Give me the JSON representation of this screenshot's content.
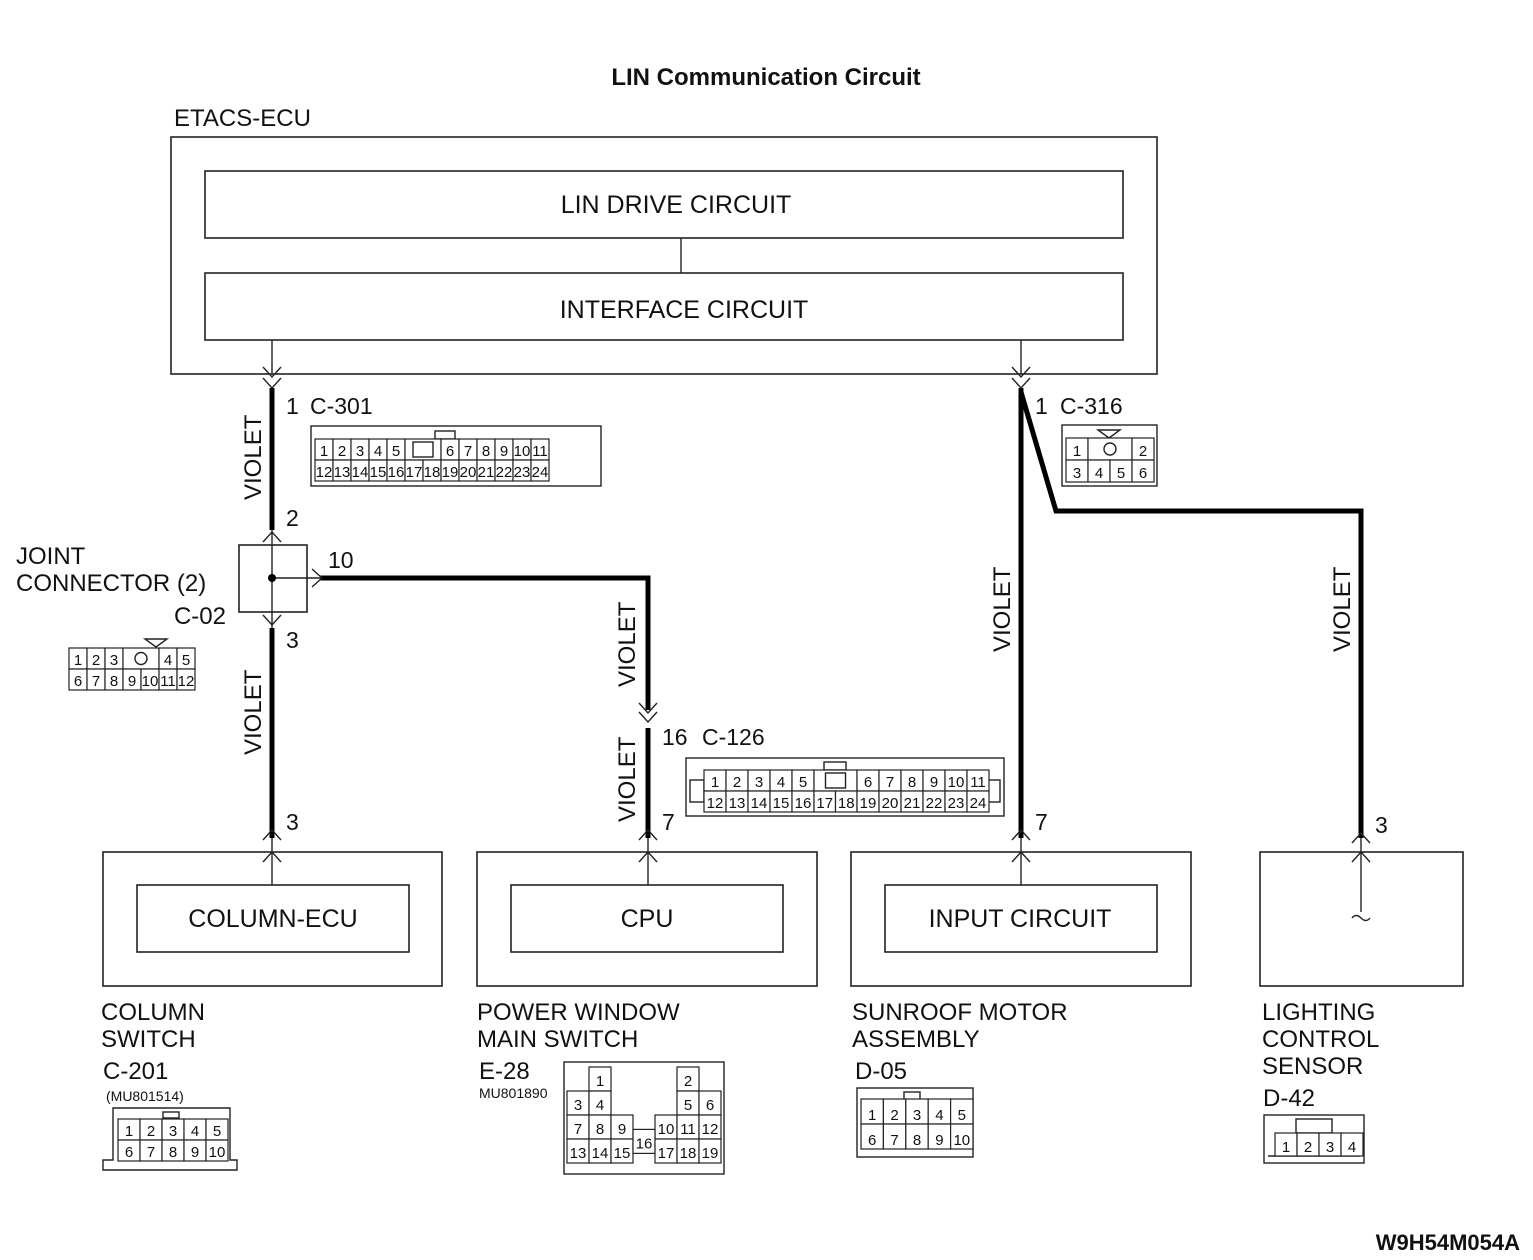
{
  "title": "LIN Communication Circuit",
  "footer_code": "W9H54M054A",
  "wire_color_label": "VIOLET",
  "etacs": {
    "name": "ETACS-ECU",
    "lin_drive": "LIN DRIVE CIRCUIT",
    "interface": "INTERFACE CIRCUIT"
  },
  "connectors": {
    "c301": {
      "pin": "1",
      "id": "C-301",
      "rows": [
        [
          "1",
          "2",
          "3",
          "4",
          "5",
          "",
          "6",
          "7",
          "8",
          "9",
          "10",
          "11"
        ],
        [
          "12",
          "13",
          "14",
          "15",
          "16",
          "17",
          "18",
          "19",
          "20",
          "21",
          "22",
          "23",
          "24"
        ]
      ]
    },
    "c316": {
      "pin": "1",
      "id": "C-316",
      "rows": [
        [
          "1",
          "O",
          "2"
        ],
        [
          "3",
          "4",
          "5",
          "6"
        ]
      ]
    },
    "joint": {
      "name_line1": "JOINT",
      "name_line2": "CONNECTOR (2)",
      "id": "C-02",
      "pin_in": "2",
      "pin_out_right": "10",
      "pin_out_down": "3",
      "rows": [
        [
          "1",
          "2",
          "3",
          "O",
          "4",
          "5"
        ],
        [
          "6",
          "7",
          "8",
          "9",
          "10",
          "11",
          "12"
        ]
      ]
    },
    "c126": {
      "pin": "16",
      "id": "C-126",
      "rows": [
        [
          "1",
          "2",
          "3",
          "4",
          "5",
          "",
          "6",
          "7",
          "8",
          "9",
          "10",
          "11"
        ],
        [
          "12",
          "13",
          "14",
          "15",
          "16",
          "17",
          "18",
          "19",
          "20",
          "21",
          "22",
          "23",
          "24"
        ]
      ]
    }
  },
  "devices": [
    {
      "key": "column",
      "pin": "3",
      "inner": "COLUMN-ECU",
      "name_lines": [
        "COLUMN",
        "SWITCH"
      ],
      "conn_id": "C-201",
      "part_no": "(MU801514)",
      "rows": [
        [
          "1",
          "2",
          "3",
          "4",
          "5"
        ],
        [
          "6",
          "7",
          "8",
          "9",
          "10"
        ]
      ]
    },
    {
      "key": "pwms",
      "pin": "7",
      "inner": "CPU",
      "name_lines": [
        "POWER WINDOW",
        "MAIN SWITCH"
      ],
      "conn_id": "E-28",
      "part_no": "MU801890",
      "rows": [
        [
          "1",
          "2"
        ],
        [
          "3",
          "4",
          "5",
          "6"
        ],
        [
          "7",
          "8",
          "9",
          "10",
          "11",
          "12"
        ],
        [
          "13",
          "14",
          "15",
          "16",
          "17",
          "18",
          "19"
        ]
      ]
    },
    {
      "key": "sunroof",
      "pin": "7",
      "inner": "INPUT CIRCUIT",
      "name_lines": [
        "SUNROOF MOTOR",
        "ASSEMBLY"
      ],
      "conn_id": "D-05",
      "rows": [
        [
          "1",
          "2",
          "3",
          "4",
          "5"
        ],
        [
          "6",
          "7",
          "8",
          "9",
          "10"
        ]
      ]
    },
    {
      "key": "lighting",
      "pin": "3",
      "inner": "",
      "name_lines": [
        "LIGHTING",
        "CONTROL",
        "SENSOR"
      ],
      "conn_id": "D-42",
      "rows": [
        [
          "1",
          "2",
          "3",
          "4"
        ]
      ]
    }
  ]
}
